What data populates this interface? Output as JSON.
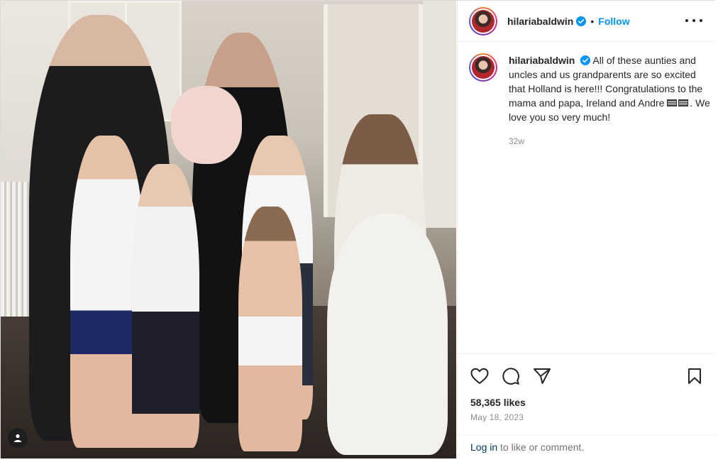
{
  "post": {
    "username": "hilariabaldwin",
    "separator": "•",
    "follow_label": "Follow",
    "caption_user": "hilariabaldwin",
    "caption_text_1": " All of these aunties and uncles and us grandparents are so excited that Holland is here!!! Congratulations to the mama and papa, Ireland and Andre ",
    "caption_text_2": ". We love you so very much!",
    "time_ago": "32w",
    "likes": "58,365 likes",
    "date": "May 18, 2023",
    "login_link": "Log in",
    "login_rest": " to like or comment."
  },
  "icons": {
    "verified": "verified-badge-icon",
    "more": "more-options-icon",
    "like": "heart-icon",
    "comment": "comment-icon",
    "share": "share-icon",
    "save": "bookmark-icon",
    "tagged": "tagged-user-icon",
    "flags": "flag-icon"
  },
  "colors": {
    "accent": "#0095f6",
    "link": "#00376b",
    "muted": "#8e8e8e"
  }
}
